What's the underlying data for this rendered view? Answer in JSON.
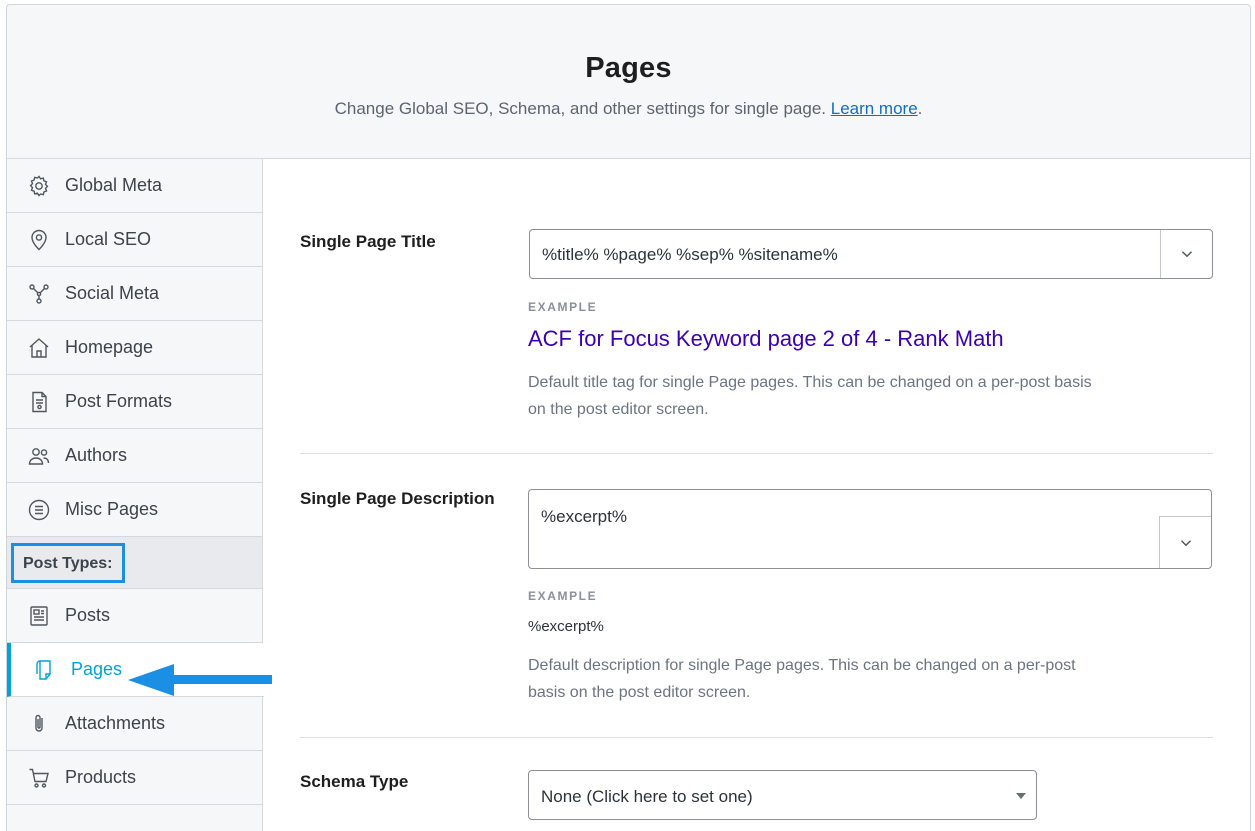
{
  "header": {
    "title": "Pages",
    "subtitle": "Change Global SEO, Schema, and other settings for single page.",
    "learn_more": "Learn more",
    "period": "."
  },
  "sidebar": {
    "items": [
      {
        "label": "Global Meta",
        "icon": "gear-icon"
      },
      {
        "label": "Local SEO",
        "icon": "location-pin-icon"
      },
      {
        "label": "Social Meta",
        "icon": "share-nodes-icon"
      },
      {
        "label": "Homepage",
        "icon": "home-icon"
      },
      {
        "label": "Post Formats",
        "icon": "document-icon"
      },
      {
        "label": "Authors",
        "icon": "users-icon"
      },
      {
        "label": "Misc Pages",
        "icon": "list-circle-icon"
      }
    ],
    "section_label": "Post Types:",
    "post_types": [
      {
        "label": "Posts",
        "icon": "post-icon"
      },
      {
        "label": "Pages",
        "icon": "page-icon",
        "active": true
      },
      {
        "label": "Attachments",
        "icon": "paperclip-icon"
      },
      {
        "label": "Products",
        "icon": "cart-icon"
      }
    ]
  },
  "form": {
    "title": {
      "label": "Single Page Title",
      "value": "%title% %page% %sep% %sitename%",
      "example_label": "EXAMPLE",
      "example_value": "ACF for Focus Keyword page 2 of 4 - Rank Math",
      "help_line1": "Default title tag for single Page pages. This can be changed on a per-post basis",
      "help_line2": "on the post editor screen."
    },
    "description": {
      "label": "Single Page Description",
      "value": "%excerpt%",
      "example_label": "EXAMPLE",
      "example_value": "%excerpt%",
      "help_line1": "Default description for single Page pages. This can be changed on a per-post",
      "help_line2": "basis on the post editor screen."
    },
    "schema": {
      "label": "Schema Type",
      "value": "None (Click here to set one)"
    }
  },
  "colors": {
    "accent": "#00a3d4",
    "highlight_border": "#1a8fe3",
    "example_title": "#3c00b3",
    "link": "#136dbf"
  }
}
